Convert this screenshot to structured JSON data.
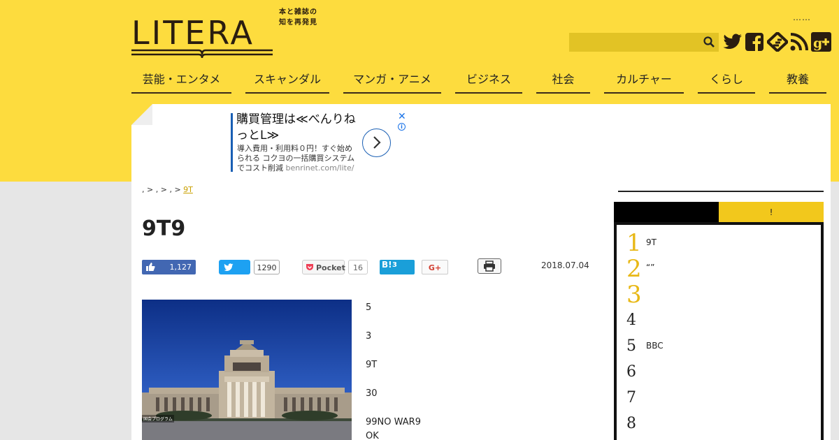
{
  "header": {
    "logo": "LITERA",
    "tagline_1": "本と雑誌の",
    "tagline_2": "知を再発見",
    "top_dots": "……",
    "search_placeholder": "",
    "social_icons": [
      "twitter-icon",
      "facebook-icon",
      "feedly-icon",
      "rss-icon",
      "google-plus-icon"
    ]
  },
  "nav": [
    "芸能・エンタメ",
    "スキャンダル",
    "マンガ・アニメ",
    "ビジネス",
    "社会",
    "カルチャー",
    "くらし",
    "教養"
  ],
  "ad": {
    "title": "購買管理は≪べんりねっとL≫",
    "description": "導入費用・利用料０円！すぐ始められる コクヨの一括購買システムでコスト削減",
    "url": "benrinet.com/lite/",
    "close": "✕",
    "info": "i"
  },
  "breadcrumb": {
    "sep": ">",
    "current": "9T"
  },
  "article": {
    "title": "9T9",
    "date": "2018.07.04",
    "photo_caption": "国会プログラム",
    "paragraphs": [
      "5",
      "3",
      "9T",
      "30",
      "99NO WAR9",
      "OK"
    ]
  },
  "share": {
    "facebook_count": "1,127",
    "twitter_count": "1290",
    "pocket_label": "Pocket",
    "pocket_count": "16",
    "hatena_label": "B!",
    "hatena_count": "3",
    "gplus_label": "G+"
  },
  "ranking": {
    "tab_b": "!",
    "items": [
      {
        "num": "1",
        "text": "9T"
      },
      {
        "num": "2",
        "text": "“”"
      },
      {
        "num": "3",
        "text": ""
      },
      {
        "num": "4",
        "text": ""
      },
      {
        "num": "5",
        "text": "BBC"
      },
      {
        "num": "6",
        "text": ""
      },
      {
        "num": "7",
        "text": ""
      },
      {
        "num": "8",
        "text": ""
      }
    ]
  },
  "colors": {
    "brand_yellow": "#fddc3e",
    "accent_gold": "#f2c81c",
    "facebook": "#4267b2",
    "twitter": "#1da1f2",
    "hatena": "#1a9fd9"
  }
}
